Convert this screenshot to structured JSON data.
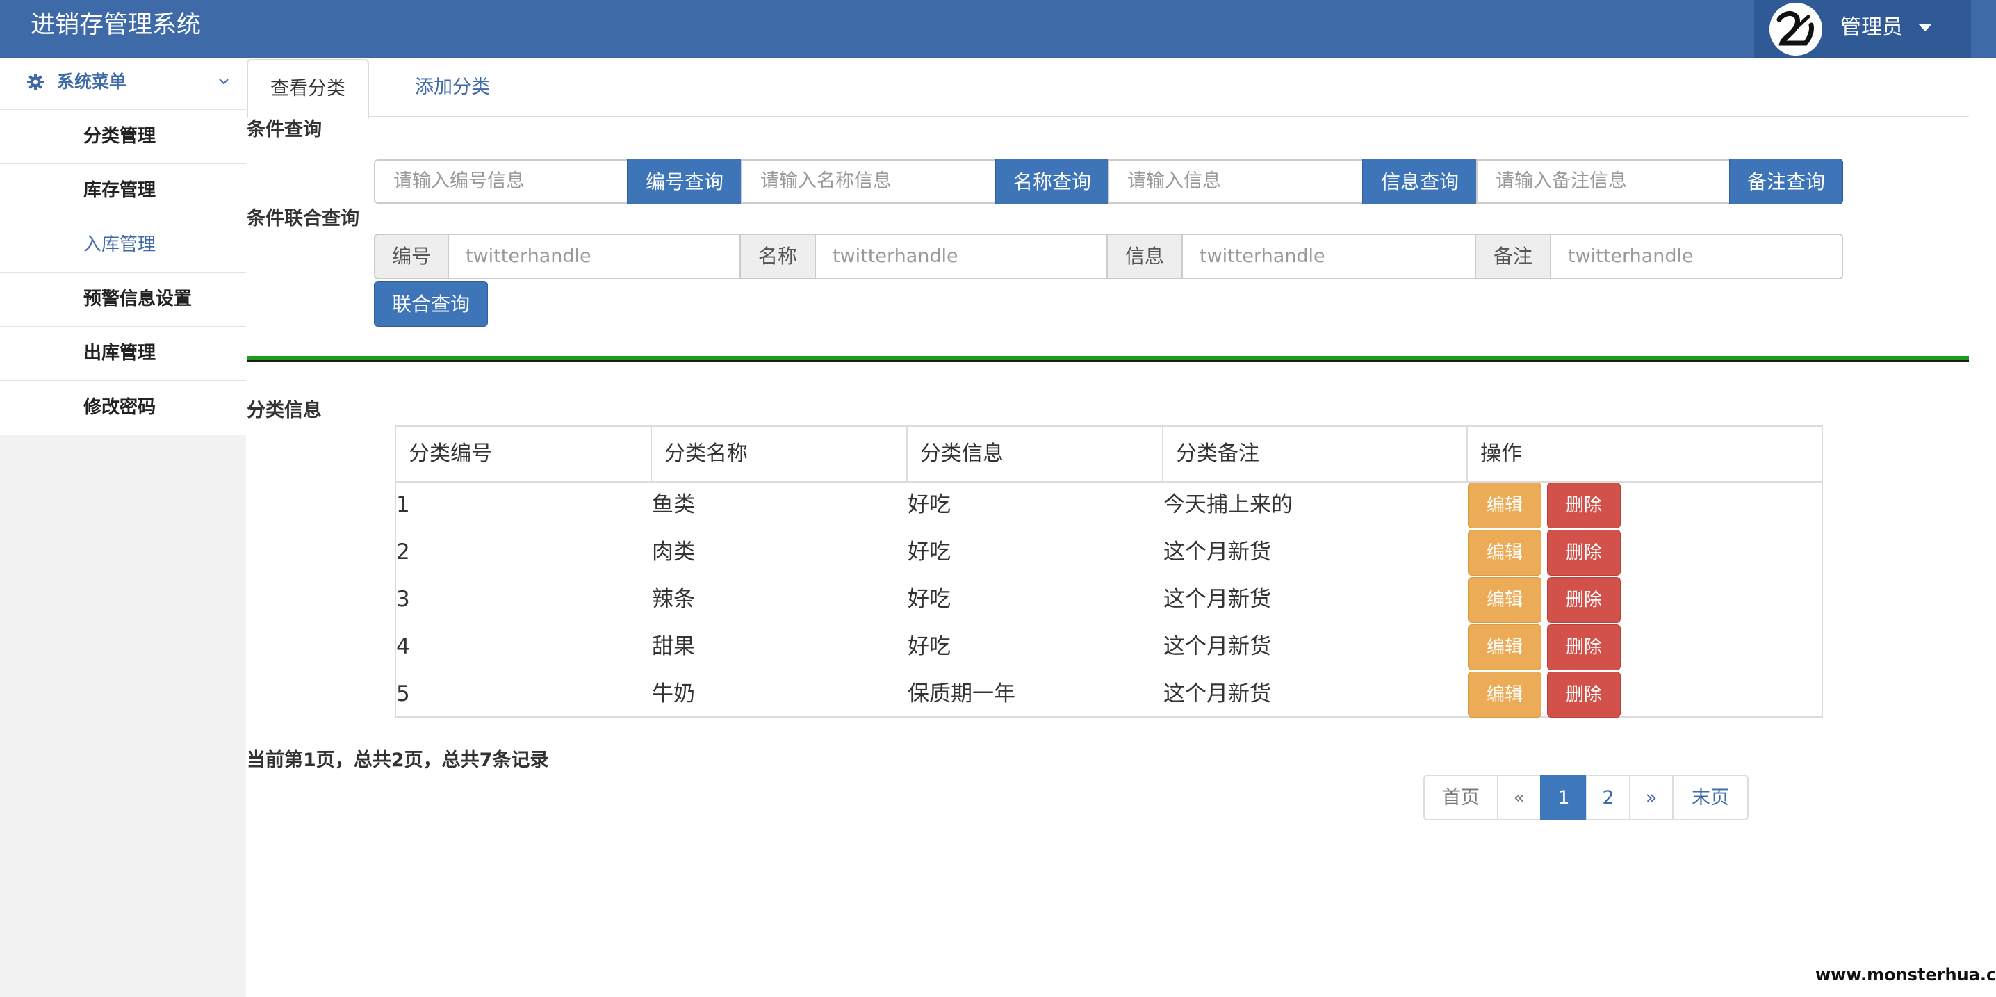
{
  "header": {
    "title": "进销存管理系统",
    "user": "管理员"
  },
  "sidebar": {
    "menu_title": "系统菜单",
    "items": [
      {
        "label": "分类管理"
      },
      {
        "label": "库存管理"
      },
      {
        "label": "入库管理"
      },
      {
        "label": "预警信息设置"
      },
      {
        "label": "出库管理"
      },
      {
        "label": "修改密码"
      }
    ]
  },
  "tabs": [
    {
      "label": "查看分类"
    },
    {
      "label": "添加分类"
    }
  ],
  "query": {
    "title": "条件查询",
    "fields": [
      {
        "placeholder": "请输入编号信息",
        "button": "编号查询"
      },
      {
        "placeholder": "请输入名称信息",
        "button": "名称查询"
      },
      {
        "placeholder": "请输入信息",
        "button": "信息查询"
      },
      {
        "placeholder": "请输入备注信息",
        "button": "备注查询"
      }
    ]
  },
  "combo_query": {
    "title": "条件联合查询",
    "fields": [
      {
        "label": "编号",
        "placeholder": "twitterhandle"
      },
      {
        "label": "名称",
        "placeholder": "twitterhandle"
      },
      {
        "label": "信息",
        "placeholder": "twitterhandle"
      },
      {
        "label": "备注",
        "placeholder": "twitterhandle"
      }
    ],
    "button": "联合查询"
  },
  "table": {
    "title": "分类信息",
    "columns": [
      "分类编号",
      "分类名称",
      "分类信息",
      "分类备注",
      "操作"
    ],
    "rows": [
      {
        "id": "1",
        "name": "鱼类",
        "info": "好吃",
        "note": "今天捕上来的"
      },
      {
        "id": "2",
        "name": "肉类",
        "info": "好吃",
        "note": "这个月新货"
      },
      {
        "id": "3",
        "name": "辣条",
        "info": "好吃",
        "note": "这个月新货"
      },
      {
        "id": "4",
        "name": "甜果",
        "info": "好吃",
        "note": "这个月新货"
      },
      {
        "id": "5",
        "name": "牛奶",
        "info": "保质期一年",
        "note": "这个月新货"
      }
    ],
    "edit_label": "编辑",
    "delete_label": "删除"
  },
  "pagination": {
    "info": "当前第1页，总共2页，总共7条记录",
    "first": "首页",
    "prev": "«",
    "pages": [
      "1",
      "2"
    ],
    "current": "1",
    "next": "»",
    "last": "末页"
  },
  "watermark": "www.monsterhua.com",
  "colors": {
    "primary": "#3e6aa8",
    "edit": "#ecac57",
    "delete": "#d2524b",
    "divider": "#1e9b1e"
  }
}
